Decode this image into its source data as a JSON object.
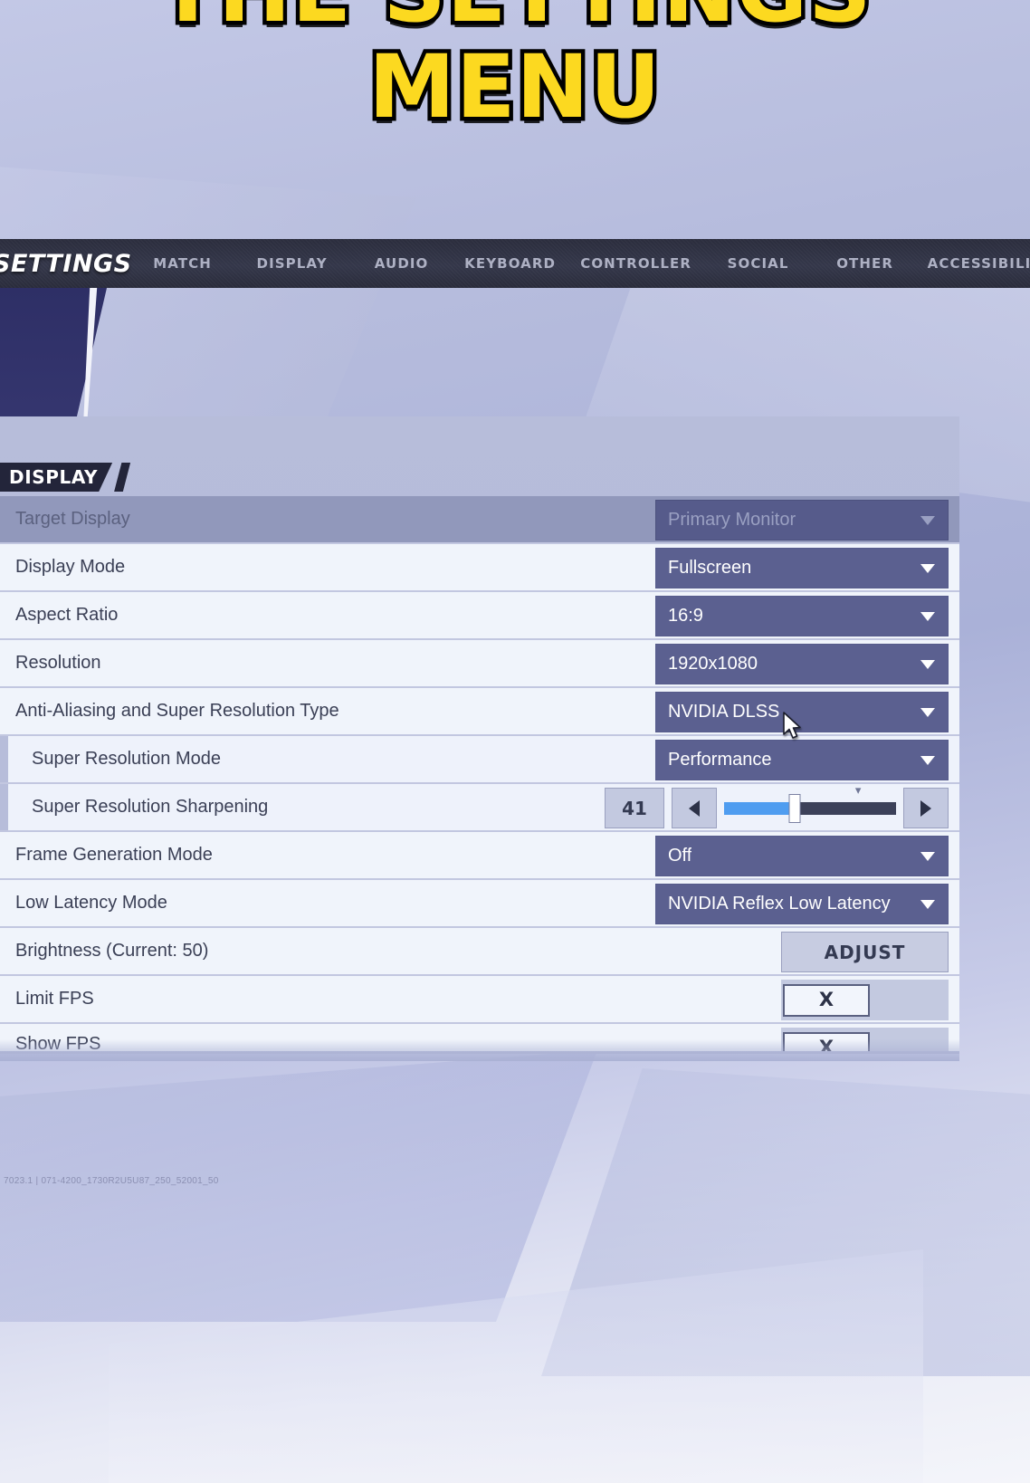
{
  "caption": {
    "line1": "THE SETTINGS",
    "line2": "MENU",
    "color": "#fcd920",
    "outline_color": "#000000"
  },
  "navbar": {
    "brand": "SETTINGS",
    "items": [
      {
        "label": "MATCH"
      },
      {
        "label": "DISPLAY"
      },
      {
        "label": "AUDIO"
      },
      {
        "label": "KEYBOARD"
      },
      {
        "label": "CONTROLLER"
      },
      {
        "label": "SOCIAL"
      },
      {
        "label": "OTHER"
      },
      {
        "label": "ACCESSIBILITY"
      }
    ],
    "background": "#2e3040",
    "text_color": "#aeb1c4"
  },
  "panel": {
    "section_title": "DISPLAY",
    "accent_dropdown": "#5b6090",
    "row_background": "#f0f4fb",
    "disabled_row_background": "#9198bb",
    "slider_fill": "#4f9df0",
    "rows": [
      {
        "label": "Target Display",
        "value": "Primary Monitor"
      },
      {
        "label": "Display Mode",
        "value": "Fullscreen"
      },
      {
        "label": "Aspect Ratio",
        "value": "16:9"
      },
      {
        "label": "Resolution",
        "value": "1920x1080"
      },
      {
        "label": "Anti-Aliasing and Super Resolution Type",
        "value": "NVIDIA DLSS"
      },
      {
        "label": "Super Resolution Mode",
        "value": "Performance"
      },
      {
        "label": "Super Resolution Sharpening",
        "value": "41"
      },
      {
        "label": "Frame Generation Mode",
        "value": "Off"
      },
      {
        "label": "Low Latency Mode",
        "value": "NVIDIA Reflex Low Latency"
      },
      {
        "label": "Brightness (Current: 50)",
        "value": "ADJUST"
      },
      {
        "label": "Limit FPS",
        "value": "X"
      },
      {
        "label": "Show FPS",
        "value": "X"
      }
    ],
    "sharpening_slider": {
      "value": "41",
      "percent": 41,
      "min": 0,
      "max": 100,
      "decrement_label": "◀",
      "increment_label": "▶",
      "default_marker_percent": 78
    }
  },
  "watermark": {
    "text": "7023.1 | 071-4200_1730R2U5U87_250_52001_50"
  }
}
